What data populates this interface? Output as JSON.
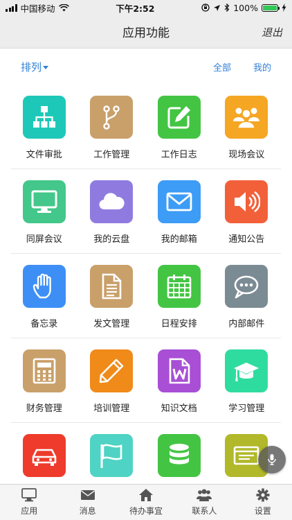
{
  "status_bar": {
    "carrier": "中国移动",
    "time": "下午2:52",
    "battery": "100%",
    "icons": [
      "signal-icon",
      "wifi-icon",
      "orientation-lock-icon",
      "location-arrow-icon",
      "bluetooth-icon",
      "battery-icon",
      "charging-icon"
    ]
  },
  "header": {
    "title": "应用功能",
    "exit_label": "退出"
  },
  "toolbar": {
    "sort_label": "排列",
    "all_label": "全部",
    "mine_label": "我的"
  },
  "apps": [
    {
      "label": "文件审批",
      "icon": "org-chart-icon",
      "color": "#1ec8b8"
    },
    {
      "label": "工作管理",
      "icon": "branch-icon",
      "color": "#c9a06a"
    },
    {
      "label": "工作日志",
      "icon": "edit-icon",
      "color": "#43c543"
    },
    {
      "label": "现场会议",
      "icon": "group-icon",
      "color": "#f5a623"
    },
    {
      "label": "同屏会议",
      "icon": "monitor-icon",
      "color": "#43c78a"
    },
    {
      "label": "我的云盘",
      "icon": "cloud-icon",
      "color": "#8f7be0"
    },
    {
      "label": "我的邮箱",
      "icon": "mail-icon",
      "color": "#3d9cf5"
    },
    {
      "label": "通知公告",
      "icon": "speaker-icon",
      "color": "#f2603a"
    },
    {
      "label": "备忘录",
      "icon": "hand-icon",
      "color": "#3d8ff5"
    },
    {
      "label": "发文管理",
      "icon": "document-icon",
      "color": "#c9a06a"
    },
    {
      "label": "日程安排",
      "icon": "calendar-icon",
      "color": "#43c543"
    },
    {
      "label": "内部邮件",
      "icon": "chat-icon",
      "color": "#7b8b93"
    },
    {
      "label": "财务管理",
      "icon": "calculator-icon",
      "color": "#c9a06a"
    },
    {
      "label": "培训管理",
      "icon": "pencil-icon",
      "color": "#f08a19"
    },
    {
      "label": "知识文档",
      "icon": "word-doc-icon",
      "color": "#a84fd6"
    },
    {
      "label": "学习管理",
      "icon": "graduation-cap-icon",
      "color": "#2fdca0"
    },
    {
      "label": "",
      "icon": "car-icon",
      "color": "#ee3b2b"
    },
    {
      "label": "",
      "icon": "flag-icon",
      "color": "#4fd3c4"
    },
    {
      "label": "",
      "icon": "database-icon",
      "color": "#43c543"
    },
    {
      "label": "",
      "icon": "id-card-icon",
      "color": "#b1b82a"
    }
  ],
  "tabs": [
    {
      "label": "应用",
      "icon": "monitor-icon"
    },
    {
      "label": "消息",
      "icon": "envelope-icon"
    },
    {
      "label": "待办事宜",
      "icon": "home-icon"
    },
    {
      "label": "联系人",
      "icon": "people-icon"
    },
    {
      "label": "设置",
      "icon": "gear-icon"
    }
  ],
  "fab": {
    "icon": "microphone-icon"
  }
}
